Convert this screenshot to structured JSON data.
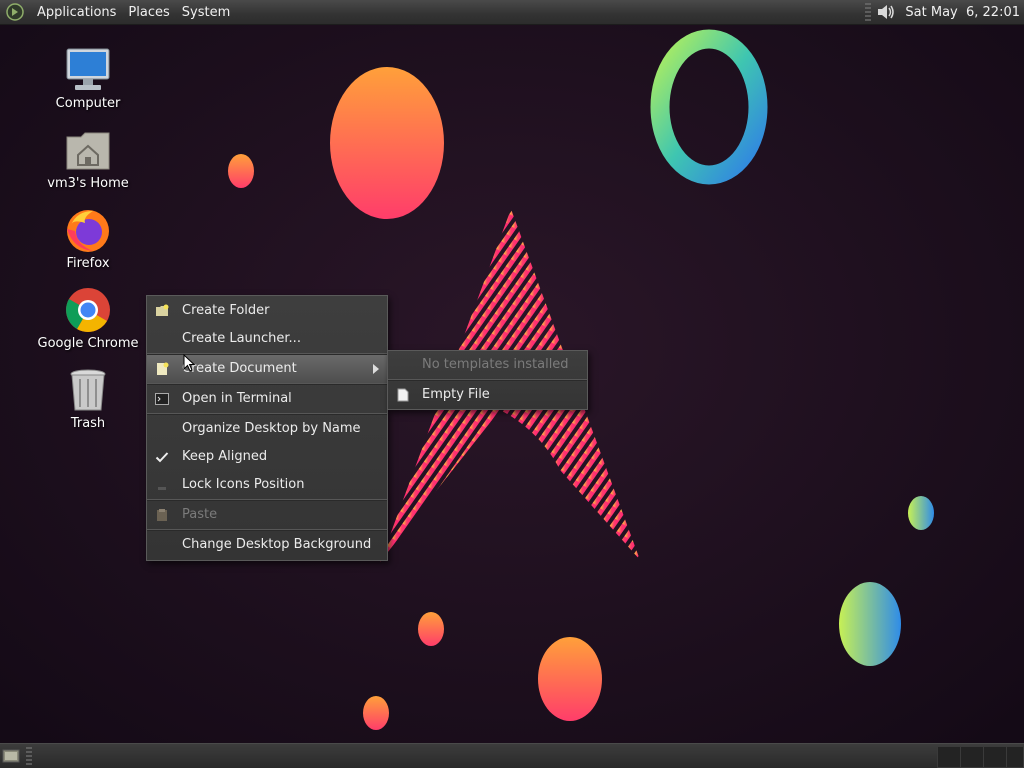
{
  "top_panel": {
    "menus": [
      "Applications",
      "Places",
      "System"
    ],
    "clock": "Sat May  6, 22:01",
    "icons": [
      "mate-menu-icon",
      "speaker-volume-icon"
    ]
  },
  "desktop": {
    "icons": [
      {
        "label": "Computer",
        "icon": "computer-icon"
      },
      {
        "label": "vm3's Home",
        "icon": "home-folder-icon"
      },
      {
        "label": "Firefox",
        "icon": "firefox-icon"
      },
      {
        "label": "Google Chrome",
        "icon": "chrome-icon"
      },
      {
        "label": "Trash",
        "icon": "trash-icon"
      }
    ]
  },
  "context_menu": {
    "items": [
      {
        "label": "Create Folder",
        "icon": "folder-new-icon"
      },
      {
        "label": "Create Launcher...",
        "icon": ""
      },
      {
        "label": "Create Document",
        "icon": "document-new-icon",
        "submenu": true,
        "highlighted": true
      },
      {
        "label": "Open in Terminal",
        "icon": "terminal-icon"
      },
      {
        "label": "Organize Desktop by Name",
        "icon": ""
      },
      {
        "label": "Keep Aligned",
        "icon": "checkmark-icon",
        "checked": true
      },
      {
        "label": "Lock Icons Position",
        "icon": "checkbox-off-icon"
      },
      {
        "label": "Paste",
        "icon": "paste-icon",
        "disabled": true
      },
      {
        "label": "Change Desktop Background",
        "icon": ""
      }
    ]
  },
  "submenu": {
    "items": [
      {
        "label": "No templates installed",
        "disabled": true
      },
      {
        "label": "Empty File",
        "icon": "text-file-icon"
      }
    ]
  },
  "colors": {
    "wallpaper_bg": "#1b0e1d",
    "accent_pink": "#ff2d7a",
    "accent_orange": "#ff9a3c",
    "menu_bg": "#3a3a3a"
  }
}
